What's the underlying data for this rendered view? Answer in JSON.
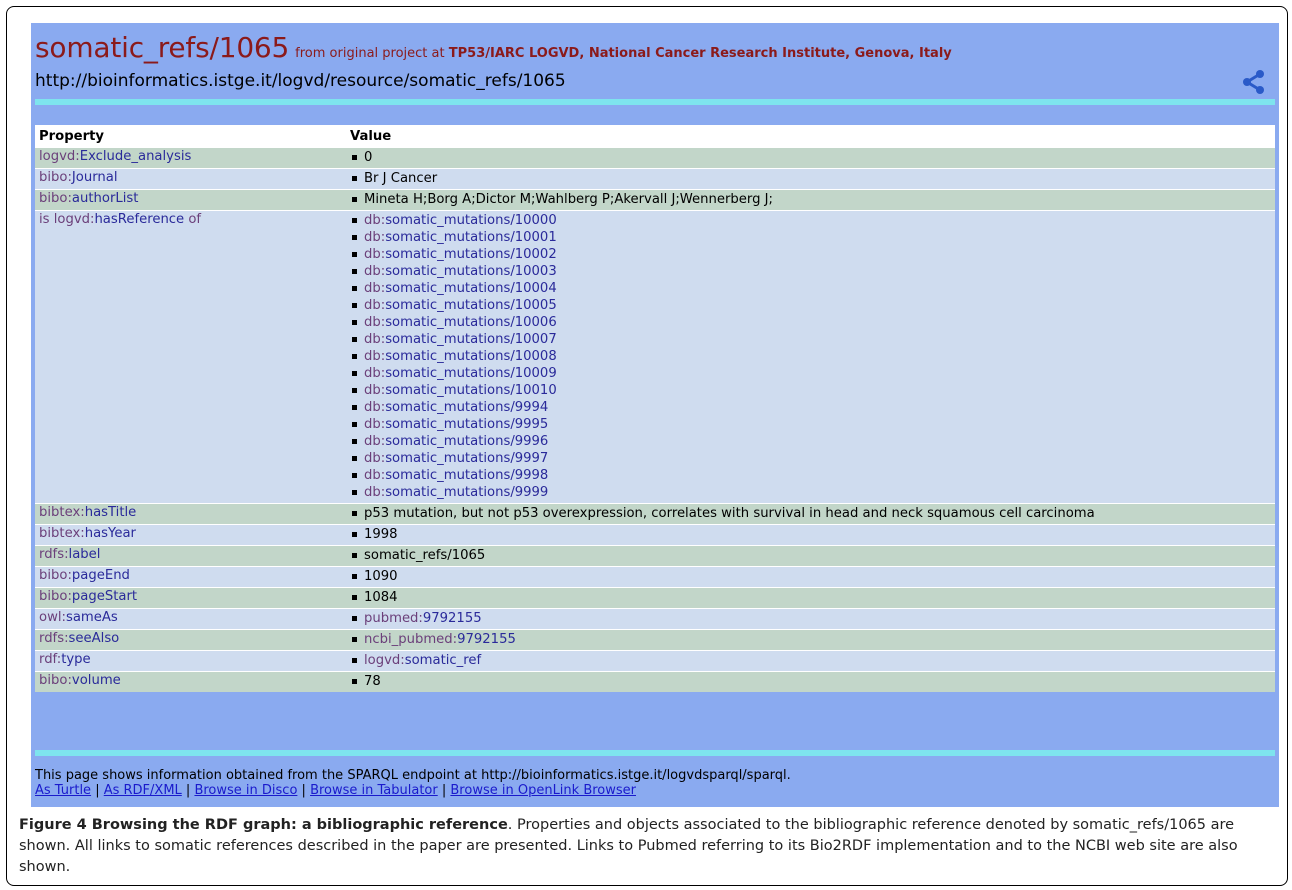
{
  "header": {
    "title": "somatic_refs/1065",
    "from_prefix": "from original project at",
    "from_source": "TP53/IARC LOGVD, National Cancer Research Institute, Genova, Italy",
    "uri": "http://bioinformatics.istge.it/logvd/resource/somatic_refs/1065"
  },
  "table": {
    "col_property": "Property",
    "col_value": "Value",
    "rows": [
      {
        "prefix": "logvd:",
        "local": "Exclude_analysis",
        "value": "0"
      },
      {
        "prefix": "bibo:",
        "local": "Journal",
        "value": "Br J Cancer"
      },
      {
        "prefix": "bibo:",
        "local": "authorList",
        "value": "Mineta H;Borg A;Dictor M;Wahlberg P;Akervall J;Wennerberg J;"
      },
      {
        "prefix": "is logvd:",
        "local": "hasReference",
        "suffix": " of",
        "links": [
          "somatic_mutations/10000",
          "somatic_mutations/10001",
          "somatic_mutations/10002",
          "somatic_mutations/10003",
          "somatic_mutations/10004",
          "somatic_mutations/10005",
          "somatic_mutations/10006",
          "somatic_mutations/10007",
          "somatic_mutations/10008",
          "somatic_mutations/10009",
          "somatic_mutations/10010",
          "somatic_mutations/9994",
          "somatic_mutations/9995",
          "somatic_mutations/9996",
          "somatic_mutations/9997",
          "somatic_mutations/9998",
          "somatic_mutations/9999"
        ],
        "link_prefix": "db:"
      },
      {
        "prefix": "bibtex:",
        "local": "hasTitle",
        "value": "p53 mutation, but not p53 overexpression, correlates with survival in head and neck squamous cell carcinoma"
      },
      {
        "prefix": "bibtex:",
        "local": "hasYear",
        "value": "1998"
      },
      {
        "prefix": "rdfs:",
        "local": "label",
        "value": "somatic_refs/1065"
      },
      {
        "prefix": "bibo:",
        "local": "pageEnd",
        "value": "1090"
      },
      {
        "prefix": "bibo:",
        "local": "pageStart",
        "value": "1084"
      },
      {
        "prefix": "owl:",
        "local": "sameAs",
        "link_prefix": "pubmed:",
        "link_local": "9792155"
      },
      {
        "prefix": "rdfs:",
        "local": "seeAlso",
        "link_prefix": "ncbi_pubmed:",
        "link_local": "9792155"
      },
      {
        "prefix": "rdf:",
        "local": "type",
        "link_prefix": "logvd:",
        "link_local": "somatic_ref"
      },
      {
        "prefix": "bibo:",
        "local": "volume",
        "value": "78"
      }
    ]
  },
  "footer": {
    "text": "This page shows information obtained from the SPARQL endpoint at http://bioinformatics.istge.it/logvdsparql/sparql.",
    "links": [
      "As Turtle",
      "As RDF/XML",
      "Browse in Disco",
      "Browse in Tabulator",
      "Browse in OpenLink Browser"
    ]
  },
  "caption": {
    "bold": "Figure 4 Browsing the RDF graph: a bibliographic reference",
    "text": ". Properties and objects associated to the bibliographic reference denoted by somatic_refs/1065 are shown. All links to somatic references described in the paper are presented. Links to Pubmed referring to its Bio2RDF implementation and to the NCBI web site are also shown."
  },
  "colors": {
    "title": "#8b1a1a",
    "link": "#2a2a9a",
    "prefix": "#6b3f7a",
    "page_bg": "#8aaaf0",
    "accent_bar": "#7ee4ee"
  },
  "icons": {
    "share": "share-icon"
  }
}
